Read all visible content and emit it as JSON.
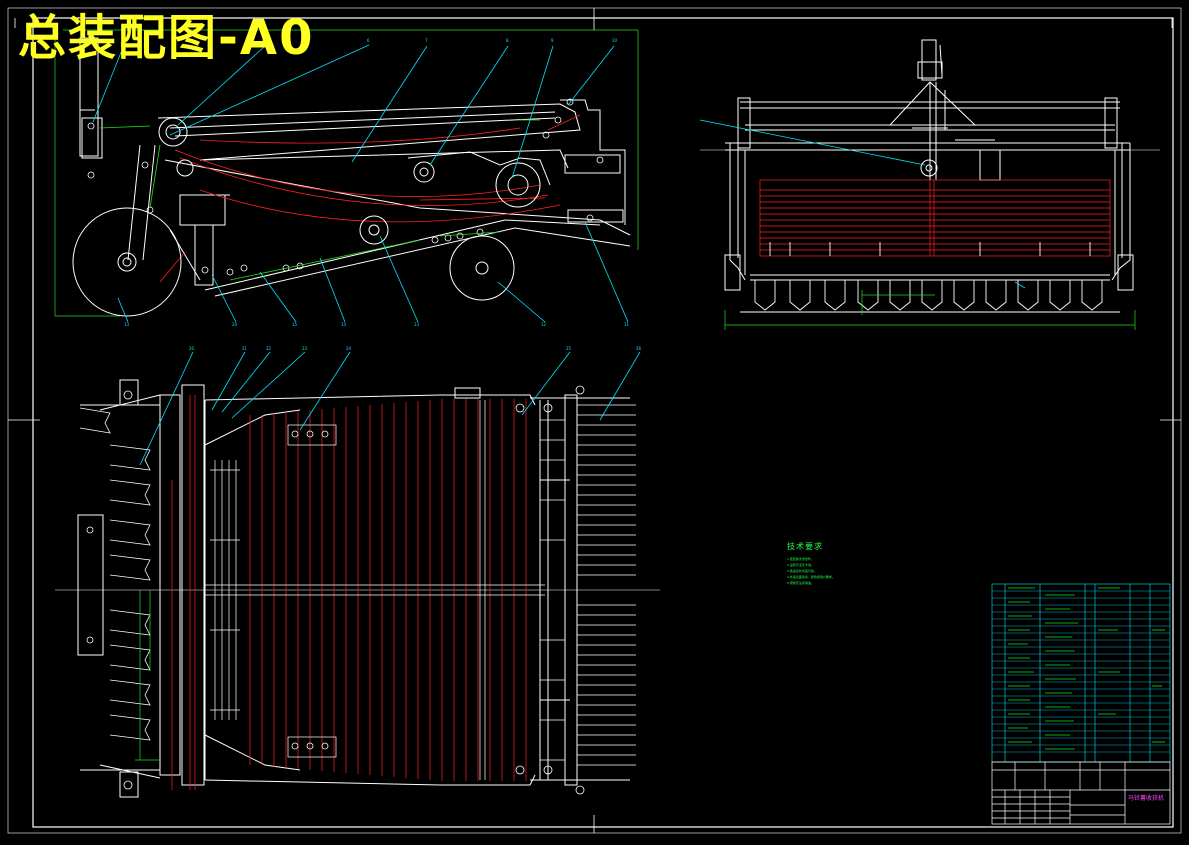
{
  "drawing": {
    "title": "总装配图-A0",
    "technical_requirements": {
      "title": "技术要求",
      "lines": [
        "1.装配前清洗零件。",
        "2.运转灵活无卡滞。",
        "3.各连接处紧固可靠。",
        "4.外露表面涂漆，颜色按用户要求。",
        "5.按规定注润滑油。"
      ]
    },
    "title_block": {
      "name": "马铃薯收获机"
    }
  },
  "colors": {
    "background": "#000000",
    "frame": "#ffffff",
    "outline": "#ffffff",
    "hidden_red": "#ff2020",
    "dimension": "#22dd22",
    "leader": "#00e5ff",
    "title_yellow": "#ffff22",
    "table_cyan": "#00e5ff",
    "table_magenta": "#ff44ff"
  }
}
